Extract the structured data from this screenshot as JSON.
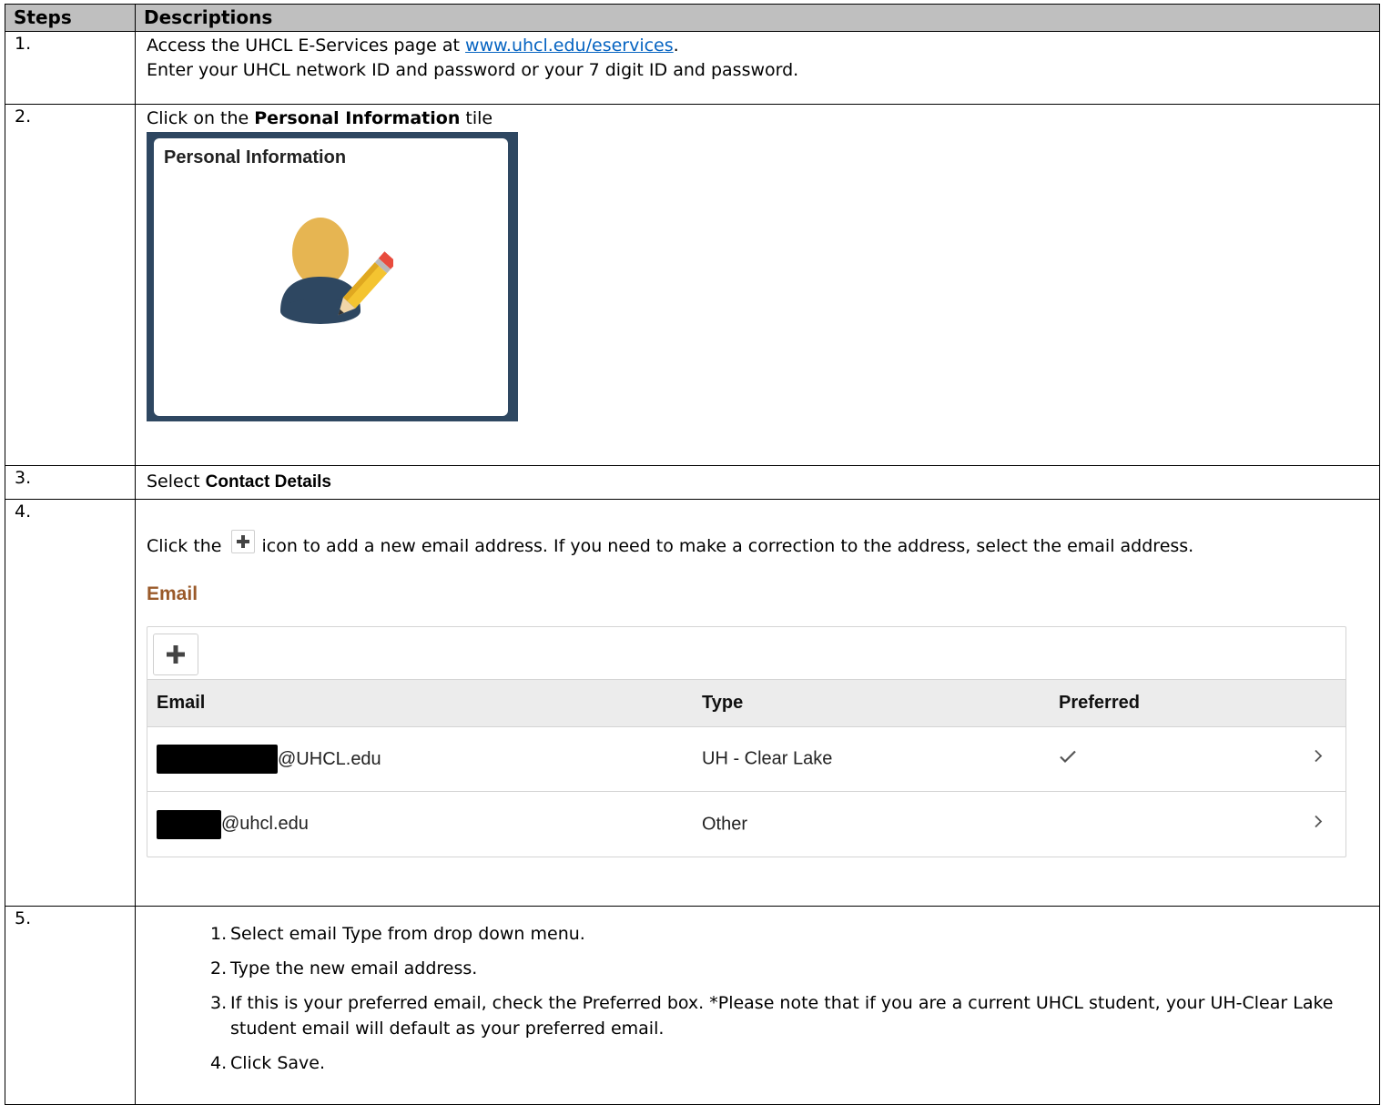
{
  "header": {
    "steps": "Steps",
    "descriptions": "Descriptions"
  },
  "step1": {
    "num": "1.",
    "line1_pre": "Access the UHCL E-Services page at ",
    "link": "www.uhcl.edu/eservices",
    "line1_post": ".",
    "line2": "Enter your UHCL network ID and password or your 7 digit ID and password."
  },
  "step2": {
    "num": "2.",
    "pre": "Click on the ",
    "bold": "Personal Information",
    "post": " tile",
    "tile_title": "Personal Information",
    "tile_icon": "person-edit-icon"
  },
  "step3": {
    "num": "3.",
    "pre": "Select ",
    "bold": "Contact Details"
  },
  "step4": {
    "num": "4.",
    "pre": "Click the",
    "post": "icon to add a new email address. If you need to make a correction to the address, select the email address.",
    "email_heading": "Email",
    "grid": {
      "columns": [
        "Email",
        "Type",
        "Preferred"
      ],
      "rows": [
        {
          "email": "@UHCL.edu",
          "type": "UH - Clear Lake",
          "preferred": true
        },
        {
          "email": "@uhcl.edu",
          "type": "Other",
          "preferred": false
        }
      ]
    }
  },
  "step5": {
    "num": "5.",
    "items": [
      {
        "n": "1.",
        "text": "Select email Type from drop down menu."
      },
      {
        "n": "2.",
        "text": "Type the new email address."
      },
      {
        "n": "3.",
        "text": "If this is your preferred email, check the Preferred box. *Please note that if you are a current UHCL student, your UH-Clear Lake student email will default as your preferred email."
      },
      {
        "n": "4.",
        "text": "Click Save."
      }
    ]
  },
  "colors": {
    "header_bg": "#bfbfbf",
    "link": "#0563c1",
    "tile_border": "#2e4761",
    "email_heading": "#9a5a2a"
  }
}
